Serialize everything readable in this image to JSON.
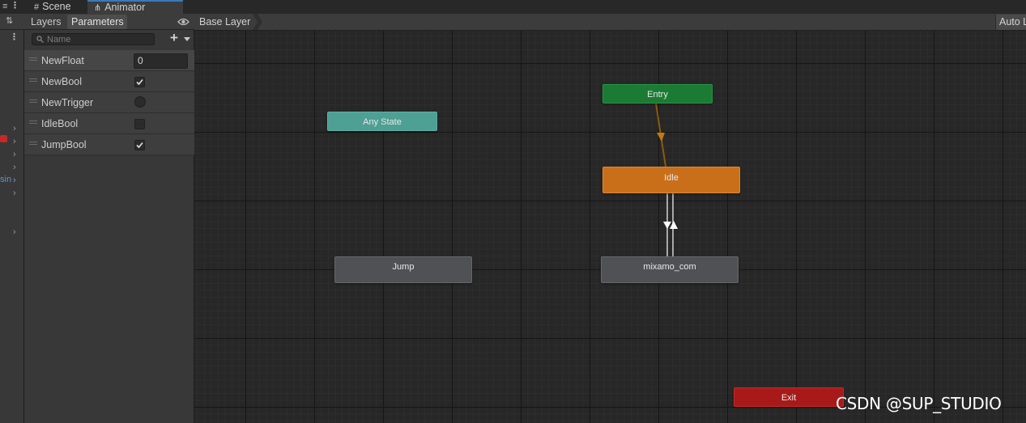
{
  "tabs": {
    "scene": "Scene",
    "animator": "Animator"
  },
  "panel": {
    "tabs": {
      "layers": "Layers",
      "parameters": "Parameters"
    },
    "search": {
      "placeholder": "Name"
    },
    "add_label": "+",
    "parameters": [
      {
        "name": "NewFloat",
        "type": "float",
        "value": "0"
      },
      {
        "name": "NewBool",
        "type": "bool",
        "checked": true
      },
      {
        "name": "NewTrigger",
        "type": "trigger"
      },
      {
        "name": "IdleBool",
        "type": "bool",
        "checked": false
      },
      {
        "name": "JumpBool",
        "type": "bool",
        "checked": true
      }
    ]
  },
  "graph": {
    "breadcrumb": "Base Layer",
    "auto_live": "Auto Live",
    "nodes": {
      "any_state": "Any State",
      "entry": "Entry",
      "idle": "Idle",
      "jump": "Jump",
      "mixamo": "mixamo_com",
      "exit": "Exit"
    }
  },
  "left_strip": {
    "fragment": "sin"
  },
  "watermark": "CSDN @SUP_STUDIO",
  "colors": {
    "entry": "#1b7a33",
    "any_state": "#4e9f94",
    "default_state": "#c96f1a",
    "state": "#4f5154",
    "exit": "#a81a1a",
    "accent": "#3a79bb"
  }
}
